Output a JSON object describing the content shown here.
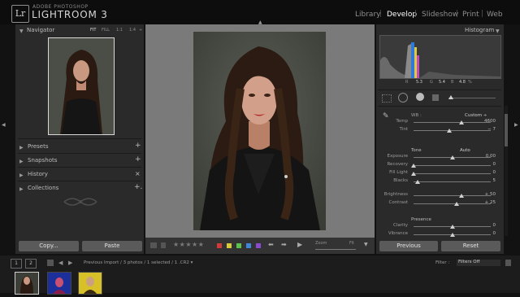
{
  "app": {
    "logo": "Lr",
    "vendor": "ADOBE PHOTOSHOP",
    "name": "LIGHTROOM 3"
  },
  "modules": {
    "library": "Library",
    "develop": "Develop",
    "slideshow": "Slideshow",
    "print": "Print",
    "web": "Web",
    "separator": "|"
  },
  "left_panel": {
    "navigator": {
      "title": "Navigator",
      "fit": "FIT",
      "fill": "FILL",
      "one_to_one": "1:1",
      "ratio": "1:4"
    },
    "sections": {
      "presets": "Presets",
      "snapshots": "Snapshots",
      "history": "History",
      "collections": "Collections"
    },
    "buttons": {
      "copy": "Copy...",
      "paste": "Paste"
    }
  },
  "toolbar": {
    "stars": "★★★★★",
    "zoom_label": "Zoom",
    "fit_label": "Fit",
    "label_colors": [
      "#d23a3a",
      "#d8c93a",
      "#5cc24a",
      "#3d86d8",
      "#8a4bd0"
    ]
  },
  "right_panel": {
    "histogram": {
      "title": "Histogram",
      "r_label": "R",
      "r_value": "5.3",
      "g_label": "G",
      "g_value": "5.4",
      "b_label": "B",
      "b_value": "4.8",
      "unit": "%"
    },
    "basic": {
      "wb_label": "WB :",
      "wb_value": "Custom ÷",
      "temp": {
        "label": "Temp",
        "value": "4600",
        "level": 0.62
      },
      "tint": {
        "label": "Tint",
        "value": "− 7",
        "level": 0.46
      },
      "tone_label": "Tone",
      "auto_label": "Auto",
      "exposure": {
        "label": "Exposure",
        "value": "0.00",
        "level": 0.5
      },
      "recovery": {
        "label": "Recovery",
        "value": "0",
        "level": 0.0
      },
      "fill_light": {
        "label": "Fill Light",
        "value": "0",
        "level": 0.0
      },
      "blacks": {
        "label": "Blacks",
        "value": "5",
        "level": 0.05
      },
      "brightness": {
        "label": "Brightness",
        "value": "+ 50",
        "level": 0.62
      },
      "contrast": {
        "label": "Contrast",
        "value": "+ 25",
        "level": 0.56
      },
      "presence_label": "Presence",
      "clarity": {
        "label": "Clarity",
        "value": "0",
        "level": 0.5
      },
      "vibrance": {
        "label": "Vibrance",
        "value": "0",
        "level": 0.5
      }
    },
    "buttons": {
      "previous": "Previous",
      "reset": "Reset"
    }
  },
  "filmstrip": {
    "page1": "1",
    "page2": "2",
    "info": "Previous Import / 3 photos / 1 selected / 1 .CR2 ▾",
    "filter_label": "Filter :",
    "filter_value": "Filters Off"
  }
}
